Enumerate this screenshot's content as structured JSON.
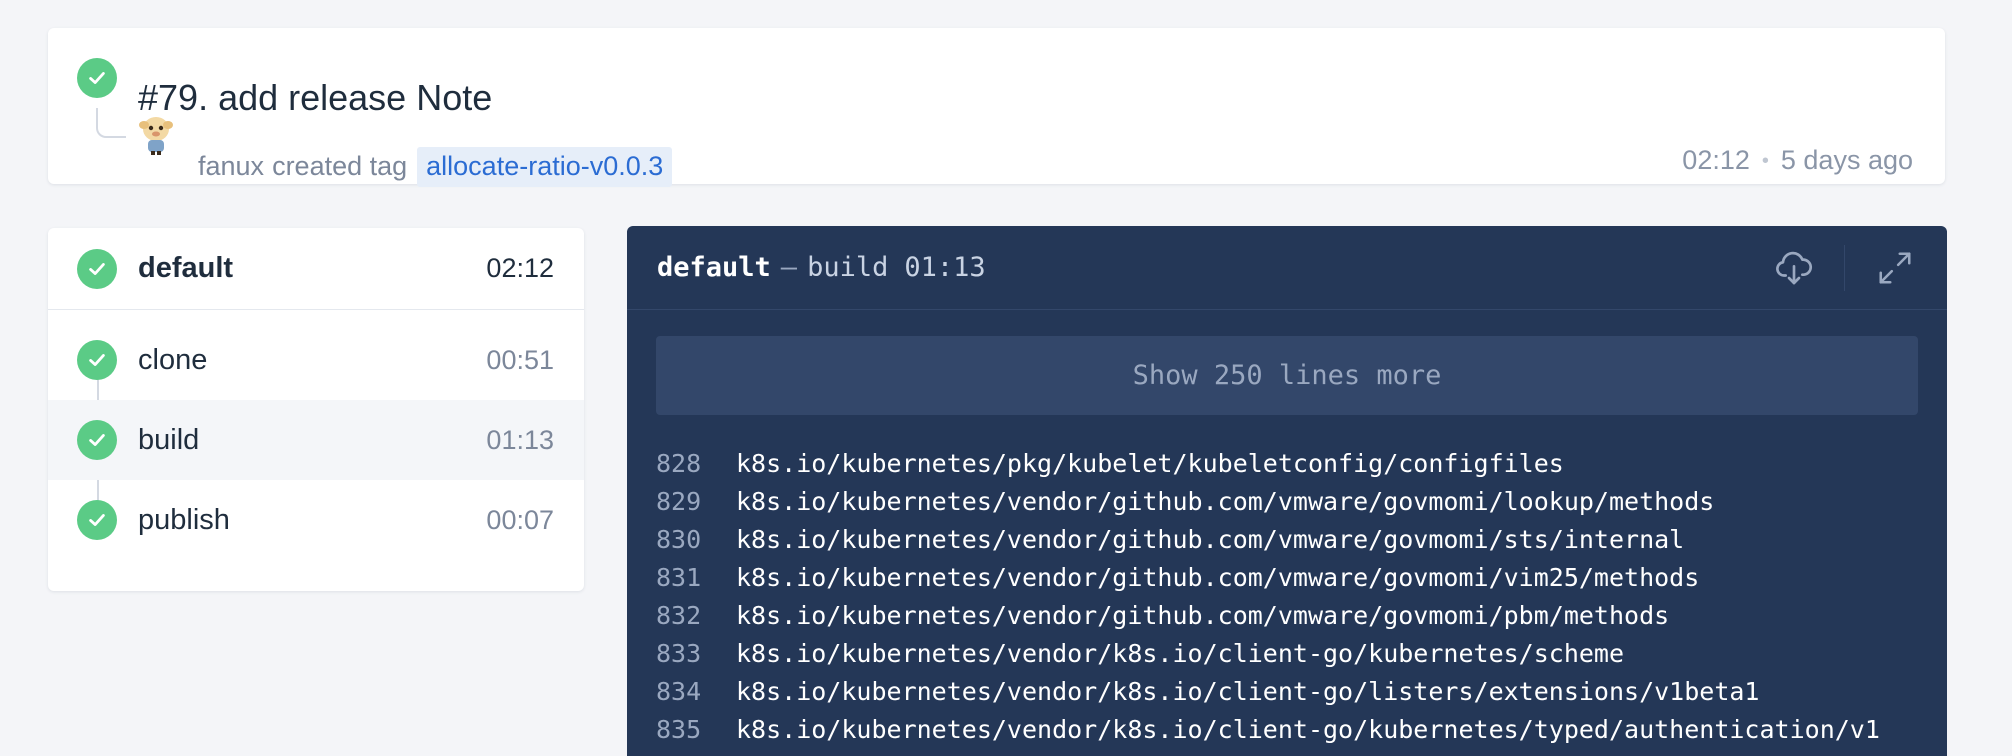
{
  "build": {
    "title": "#79. add release Note",
    "author": "fanux",
    "action": "created tag",
    "tag": "allocate-ratio-v0.0.3",
    "duration": "02:12",
    "separator": "•",
    "age": "5 days ago",
    "status_color": "#5bcb86"
  },
  "stage": {
    "name": "default",
    "duration": "02:12"
  },
  "steps": [
    {
      "name": "clone",
      "duration": "00:51"
    },
    {
      "name": "build",
      "duration": "01:13"
    },
    {
      "name": "publish",
      "duration": "00:07"
    }
  ],
  "log": {
    "stage": "default",
    "separator": "—",
    "step": "build",
    "duration": "01:13",
    "show_more_label": "Show 250 lines more",
    "icons": [
      "download-icon",
      "expand-icon"
    ],
    "lines": [
      {
        "num": "828",
        "text": "k8s.io/kubernetes/pkg/kubelet/kubeletconfig/configfiles"
      },
      {
        "num": "829",
        "text": "k8s.io/kubernetes/vendor/github.com/vmware/govmomi/lookup/methods"
      },
      {
        "num": "830",
        "text": "k8s.io/kubernetes/vendor/github.com/vmware/govmomi/sts/internal"
      },
      {
        "num": "831",
        "text": "k8s.io/kubernetes/vendor/github.com/vmware/govmomi/vim25/methods"
      },
      {
        "num": "832",
        "text": "k8s.io/kubernetes/vendor/github.com/vmware/govmomi/pbm/methods"
      },
      {
        "num": "833",
        "text": "k8s.io/kubernetes/vendor/k8s.io/client-go/kubernetes/scheme"
      },
      {
        "num": "834",
        "text": "k8s.io/kubernetes/vendor/k8s.io/client-go/listers/extensions/v1beta1"
      },
      {
        "num": "835",
        "text": "k8s.io/kubernetes/vendor/k8s.io/client-go/kubernetes/typed/authentication/v1"
      }
    ]
  },
  "colors": {
    "background": "#f4f5f8",
    "success": "#5bcb86",
    "log_background": "#243757",
    "tag_text": "#2b6cd3"
  }
}
